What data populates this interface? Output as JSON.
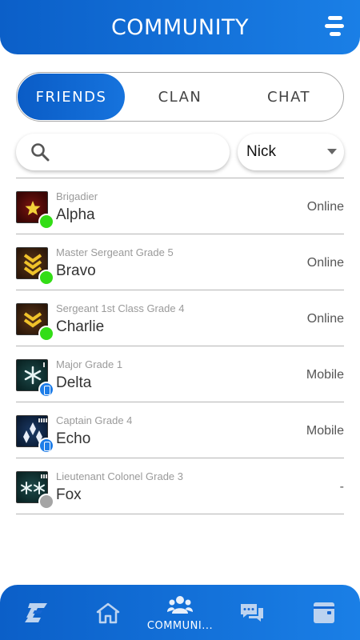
{
  "header": {
    "title": "COMMUNITY",
    "menu_icon": "menu-icon"
  },
  "tabs": [
    {
      "label": "FRIENDS",
      "active": true
    },
    {
      "label": "CLAN",
      "active": false
    },
    {
      "label": "CHAT",
      "active": false
    }
  ],
  "search": {
    "value": "",
    "placeholder": "",
    "icon": "search-icon"
  },
  "sort_select": {
    "selected": "Nick"
  },
  "friends": [
    {
      "rank": "Brigadier",
      "name": "Alpha",
      "status": "Online",
      "presence": "online",
      "badge_icon": "star-insignia-icon"
    },
    {
      "rank": "Master Sergeant Grade 5",
      "name": "Bravo",
      "status": "Online",
      "presence": "online",
      "badge_icon": "triple-chevron-insignia-icon"
    },
    {
      "rank": "Sergeant 1st Class Grade 4",
      "name": "Charlie",
      "status": "Online",
      "presence": "online",
      "badge_icon": "double-chevron-insignia-icon"
    },
    {
      "rank": "Major Grade 1",
      "name": "Delta",
      "status": "Mobile",
      "presence": "mobile",
      "badge_icon": "snowflake-insignia-icon"
    },
    {
      "rank": "Captain Grade 4",
      "name": "Echo",
      "status": "Mobile",
      "presence": "mobile",
      "badge_icon": "diamonds-insignia-icon"
    },
    {
      "rank": "Lieutenant Colonel Grade 3",
      "name": "Fox",
      "status": "-",
      "presence": "offline",
      "badge_icon": "double-snowflake-insignia-icon"
    }
  ],
  "bottom_nav": [
    {
      "icon": "game-logo-icon",
      "label": "",
      "active": false
    },
    {
      "icon": "home-icon",
      "label": "",
      "active": false
    },
    {
      "icon": "community-icon",
      "label": "COMMUNI...",
      "active": true
    },
    {
      "icon": "chat-bubbles-icon",
      "label": "",
      "active": false
    },
    {
      "icon": "wallet-icon",
      "label": "",
      "active": false
    }
  ],
  "colors": {
    "primary_blue": "#0b5fc8",
    "online_green": "#33dd16",
    "mobile_blue": "#1e7de8",
    "offline_gray": "#a5a5a5"
  }
}
